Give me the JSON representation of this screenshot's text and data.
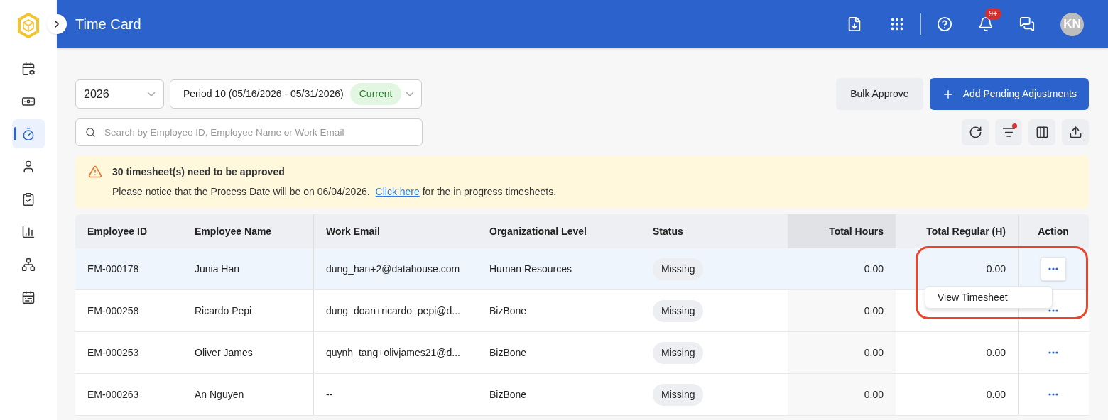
{
  "header": {
    "title": "Time Card",
    "notification_badge": "9+",
    "avatar_initials": "KN"
  },
  "sidebar": {
    "items": [
      {
        "kind": "calendar-edit",
        "selected": false
      },
      {
        "kind": "cash",
        "selected": false
      },
      {
        "kind": "timer",
        "selected": true
      },
      {
        "kind": "person",
        "selected": false
      },
      {
        "kind": "checklist",
        "selected": false
      },
      {
        "kind": "chart",
        "selected": false
      },
      {
        "kind": "hierarchy",
        "selected": false
      },
      {
        "kind": "calendar",
        "selected": false
      }
    ]
  },
  "filters": {
    "year": "2026",
    "period": "Period 10 (05/16/2026 - 05/31/2026)",
    "period_tag": "Current"
  },
  "actions": [
    "Bulk Approve",
    "Add Pending Adjustments"
  ],
  "search": {
    "placeholder": "Search by Employee ID, Employee Name or Work Email"
  },
  "toolbar": [
    {
      "kind": "refresh",
      "dot": false
    },
    {
      "kind": "filter",
      "dot": true
    },
    {
      "kind": "columns",
      "dot": false
    },
    {
      "kind": "export",
      "dot": false
    }
  ],
  "notice": {
    "title": "30 timesheet(s) need to be approved",
    "text_before": "Please notice that the Process Date will be on 06/04/2026.",
    "link": "Click here",
    "text_after": "for the in progress timesheets."
  },
  "table": {
    "columns": [
      {
        "label": "Employee ID",
        "highlighted": false
      },
      {
        "label": "Employee Name",
        "highlighted": false
      },
      {
        "label": "Work Email",
        "highlighted": false
      },
      {
        "label": "Organizational Level",
        "highlighted": false
      },
      {
        "label": "Status",
        "highlighted": false
      },
      {
        "label": "Total Hours",
        "highlighted": true
      },
      {
        "label": "Total Regular (H)",
        "highlighted": false
      },
      {
        "label": "Action",
        "highlighted": false
      }
    ],
    "rows": [
      {
        "selected": true,
        "cells": [
          "EM-000178",
          "Junia Han",
          "dung_han+2@datahouse.com",
          "Human Resources",
          "Missing",
          "0.00",
          "0.00"
        ],
        "menu_items": [
          "View Timesheet"
        ]
      },
      {
        "selected": false,
        "cells": [
          "EM-000258",
          "Ricardo Pepi",
          "dung_doan+ricardo_pepi@d...",
          "BizBone",
          "Missing",
          "0.00",
          null
        ]
      },
      {
        "selected": false,
        "cells": [
          "EM-000253",
          "Oliver James",
          "quynh_tang+olivjames21@d...",
          "BizBone",
          "Missing",
          "0.00",
          "0.00"
        ]
      },
      {
        "selected": false,
        "cells": [
          "EM-000263",
          "An Nguyen",
          "--",
          "BizBone",
          "Missing",
          "0.00",
          "0.00"
        ]
      }
    ]
  }
}
